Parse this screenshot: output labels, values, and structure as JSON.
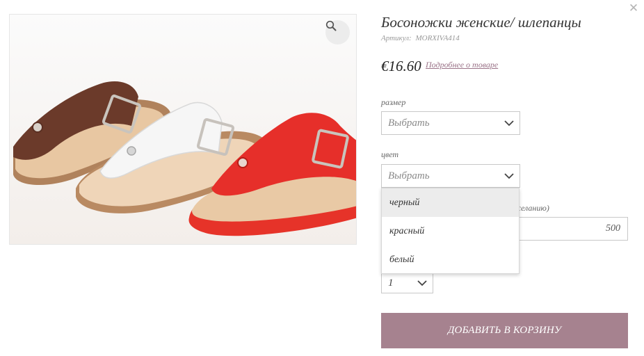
{
  "product": {
    "title": "Босоножки женские/ шлепанцы",
    "sku_label": "Артикул:",
    "sku_value": "MORXIVA414",
    "price": "€16.60",
    "details_link": "Подробнее о товаре",
    "image_alt": "sandals-photo"
  },
  "size": {
    "label": "размер",
    "value": "Выбрать"
  },
  "color": {
    "label": "цвет",
    "value": "Выбрать",
    "options": [
      "черный",
      "красный",
      "белый"
    ],
    "highlighted": "черный"
  },
  "extra": {
    "label_visible_tail": "желанию)",
    "value": "500"
  },
  "quantity": {
    "value": "1"
  },
  "cart": {
    "button_label": "ДОБАВИТЬ В КОРЗИНУ"
  },
  "colors": {
    "accent": "#a6828f",
    "link": "#9b7388",
    "sandal_brown": "#6b3a2a",
    "sandal_white": "#f4f4f4",
    "sandal_red": "#e63329",
    "sole": "#e9c9a5"
  },
  "icons": {
    "zoom": "magnifier-icon",
    "close": "close-icon",
    "chevron": "chevron-down-icon"
  }
}
